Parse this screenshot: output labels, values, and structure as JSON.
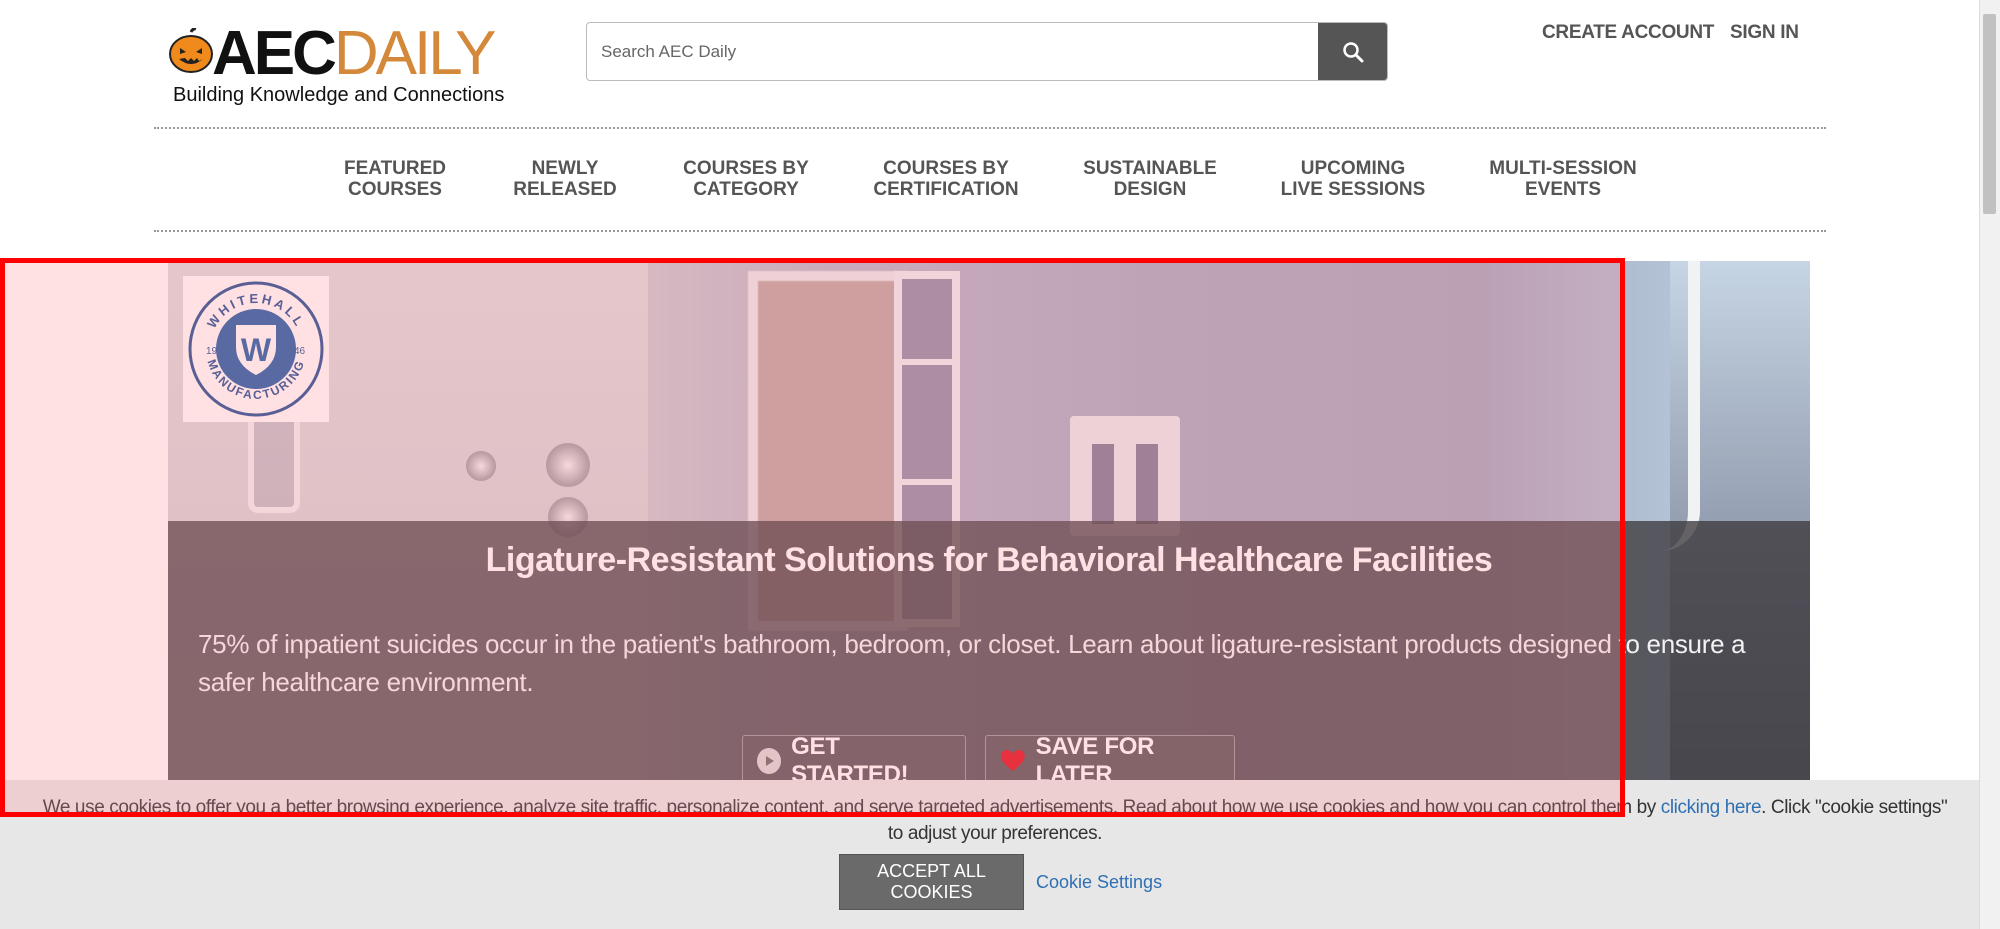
{
  "header": {
    "logo": {
      "aec": "AEC",
      "daily": "DAILY",
      "tagline": "Building Knowledge and Connections"
    },
    "search": {
      "placeholder": "Search AEC Daily"
    },
    "create_account": "CREATE ACCOUNT",
    "sign_in": "SIGN IN"
  },
  "nav": {
    "items": [
      {
        "line1": "FEATURED",
        "line2": "COURSES"
      },
      {
        "line1": "NEWLY",
        "line2": "RELEASED"
      },
      {
        "line1": "COURSES BY",
        "line2": "CATEGORY"
      },
      {
        "line1": "COURSES BY",
        "line2": "CERTIFICATION"
      },
      {
        "line1": "SUSTAINABLE",
        "line2": "DESIGN"
      },
      {
        "line1": "UPCOMING",
        "line2": "LIVE SESSIONS"
      },
      {
        "line1": "MULTI-SESSION",
        "line2": "EVENTS"
      }
    ]
  },
  "hero": {
    "sponsor_logo": {
      "top": "WHITEHALL",
      "bottom": "MANUFACTURING",
      "year_left": "19",
      "year_right": "46",
      "letter": "W"
    },
    "title": "Ligature-Resistant Solutions for Behavioral Healthcare Facilities",
    "description": "75% of inpatient suicides occur in the patient's bathroom, bedroom, or closet. Learn about ligature-resistant products designed to ensure a safer healthcare environment.",
    "get_started": "GET STARTED!",
    "save_for_later": "SAVE FOR LATER"
  },
  "cookie": {
    "icon": "",
    "text_before": "We use cookies to offer you a better browsing experience, analyze site traffic, personalize content, and serve targeted advertisements. Read about how we use cookies and how you can control them by ",
    "link": "clicking here",
    "text_after": ". Click \"cookie settings\" to adjust your preferences.",
    "accept": "ACCEPT ALL COOKIES",
    "settings": "Cookie Settings"
  },
  "colors": {
    "brand_orange": "#d3883a",
    "highlight_red": "#ff0000",
    "link_blue": "#2f6fb3",
    "heart_red": "#e0121f"
  }
}
